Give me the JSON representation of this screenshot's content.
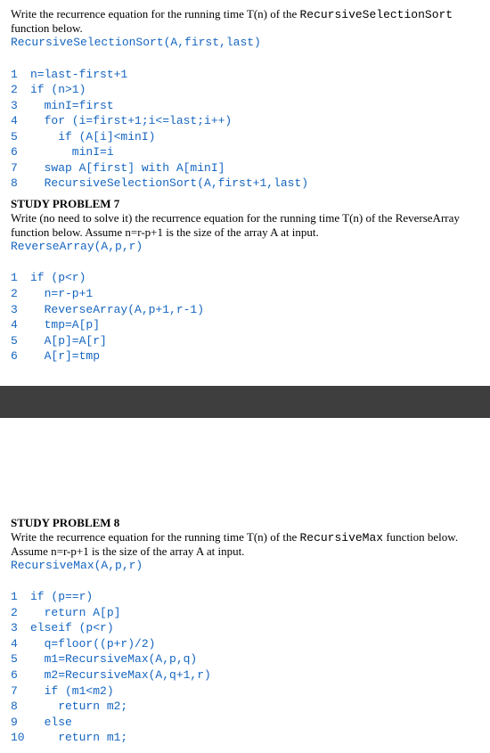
{
  "p6": {
    "intro_a": "Write the recurrence equation for the running time T(n) of the ",
    "intro_code": "RecursiveSelectionSort",
    "intro_b": " function below.",
    "sig": "RecursiveSelectionSort(A,first,last)",
    "lines": {
      "l1": "n=last-first+1",
      "l2": "if (n>1)",
      "l3": "  minI=first",
      "l4": "  for (i=first+1;i<=last;i++)",
      "l5": "    if (A[i]<minI)",
      "l6": "      minI=i",
      "l7": "  swap A[first] with A[minI]",
      "l8": "  RecursiveSelectionSort(A,first+1,last)"
    }
  },
  "p7": {
    "title": "STUDY PROBLEM 7",
    "intro": "Write (no need to solve it) the recurrence equation for the running time T(n) of the ReverseArray function below. Assume n=r-p+1 is the size of the array A at input.",
    "sig": "ReverseArray(A,p,r)",
    "lines": {
      "l1": "if (p<r)",
      "l2": "  n=r-p+1",
      "l3": "  ReverseArray(A,p+1,r-1)",
      "l4": "  tmp=A[p]",
      "l5": "  A[p]=A[r]",
      "l6": "  A[r]=tmp"
    }
  },
  "p8": {
    "title": "STUDY PROBLEM 8",
    "intro_a": "Write the recurrence equation for the running time T(n) of the ",
    "intro_code": "RecursiveMax",
    "intro_b": " function below. Assume n=r-p+1 is the size of the array A at input.",
    "sig": "RecursiveMax(A,p,r)",
    "lines": {
      "l1": "if (p==r)",
      "l2": "  return A[p]",
      "l3": "elseif (p<r)",
      "l4": "  q=floor((p+r)/2)",
      "l5": "  m1=RecursiveMax(A,p,q)",
      "l6": "  m2=RecursiveMax(A,q+1,r)",
      "l7": "  if (m1<m2)",
      "l8": "    return m2;",
      "l9": "  else",
      "l10": "    return m1;"
    }
  }
}
